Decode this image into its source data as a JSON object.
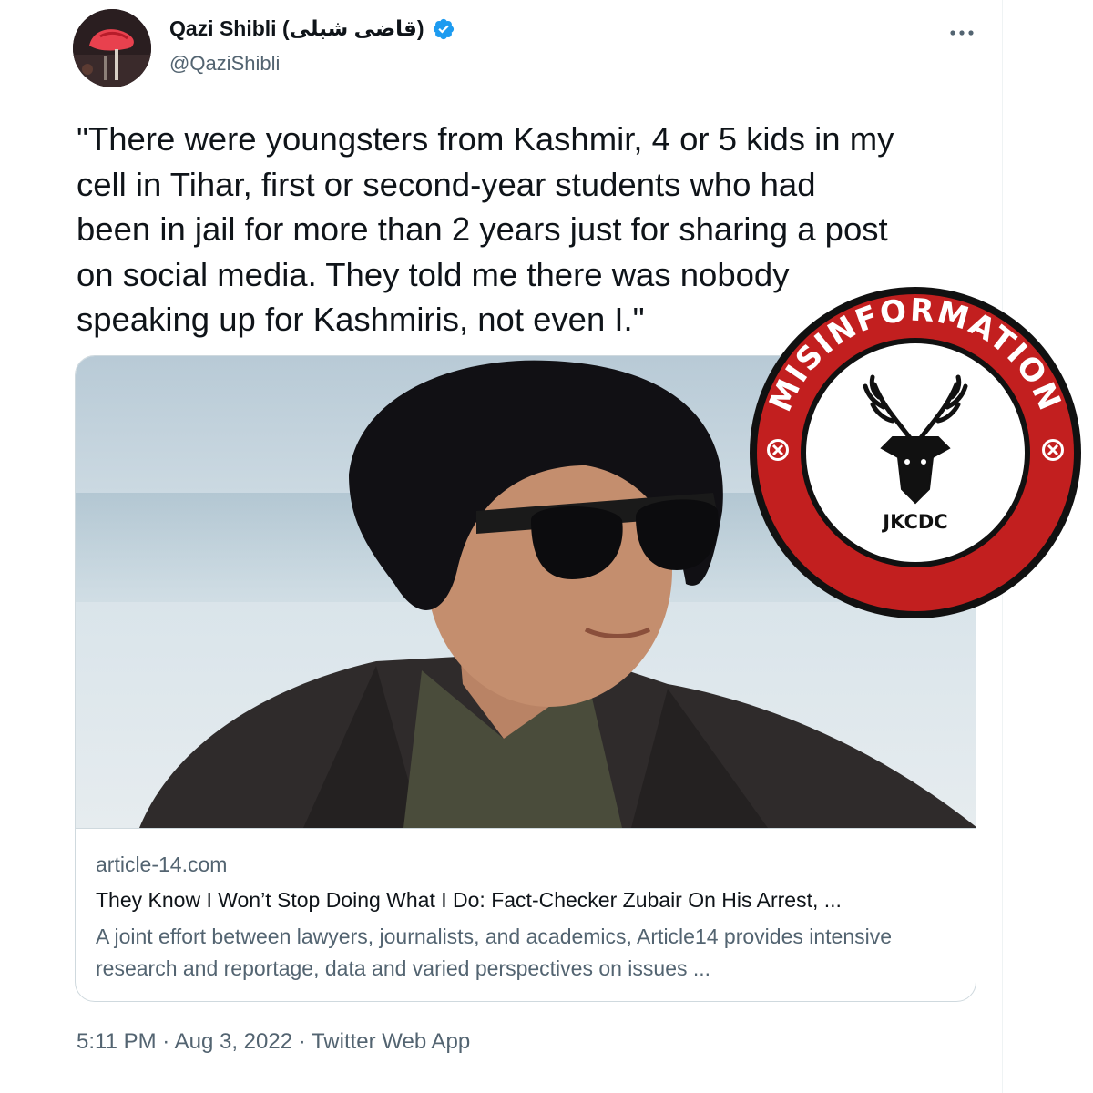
{
  "tweet": {
    "author": {
      "display_name": "Qazi Shibli (قاضی شبلی)",
      "handle": "@QaziShibli",
      "verified": true
    },
    "text": "\"There were youngsters from Kashmir, 4 or 5 kids in my\ncell in Tihar, first or second-year students who had\nbeen in jail for more than 2 years just for sharing a post\non social media. They told me there was nobody\nspeaking up for Kashmiris, not even I.\"",
    "card": {
      "domain": "article-14.com",
      "title": "They Know I Won’t Stop Doing What I Do: Fact-Checker Zubair On His Arrest, ...",
      "description": "A joint effort between lawyers, journalists, and academics, Article14 provides intensive research and reportage, data and varied perspectives on issues ..."
    },
    "meta": "5:11 PM · Aug 3, 2022 · Twitter Web App"
  },
  "stamp": {
    "arc_text": "MISINFORMATION",
    "brand": "JKCDC",
    "colors": {
      "ring": "#c21f1f",
      "outline": "#111111",
      "inner": "#ffffff"
    },
    "icons": [
      "x-circle-icon",
      "deer-head-icon"
    ]
  },
  "colors": {
    "verified_badge": "#1d9bf0",
    "secondary_text": "#536471",
    "primary_text": "#0f1419",
    "card_border": "#cfd9de"
  }
}
